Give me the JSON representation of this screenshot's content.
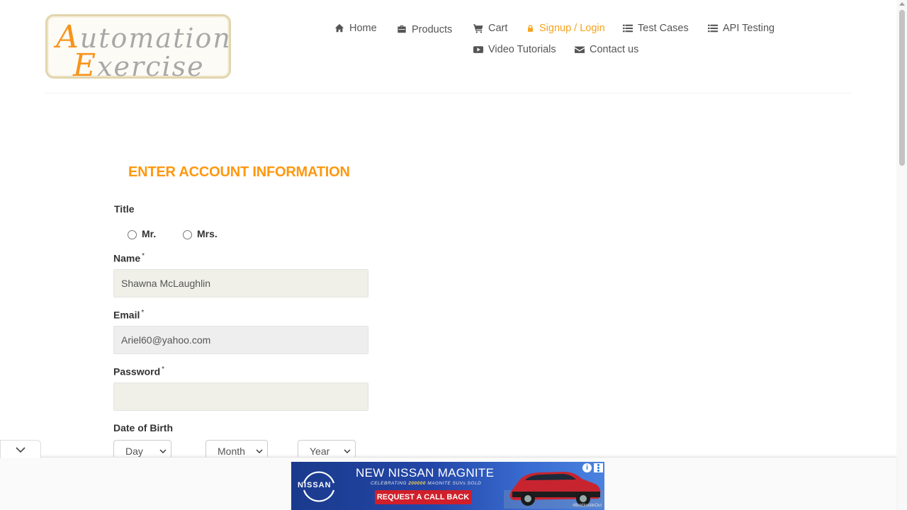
{
  "logo": {
    "line1_cap": "A",
    "line1_rest": "utomation",
    "line2_cap": "E",
    "line2_rest": "xercise"
  },
  "nav": {
    "items": [
      {
        "label": "Home",
        "icon": "home-icon",
        "active": false
      },
      {
        "label": "Products",
        "icon": "briefcase-icon",
        "active": false
      },
      {
        "label": "Cart",
        "icon": "cart-icon",
        "active": false
      },
      {
        "label": "Signup / Login",
        "icon": "lock-icon",
        "active": true
      },
      {
        "label": "Test Cases",
        "icon": "list-icon",
        "active": false
      },
      {
        "label": "API Testing",
        "icon": "list-icon",
        "active": false
      },
      {
        "label": "Video Tutorials",
        "icon": "youtube-play-icon",
        "active": false
      },
      {
        "label": "Contact us",
        "icon": "envelope-icon",
        "active": false
      }
    ]
  },
  "form": {
    "heading": "ENTER ACCOUNT INFORMATION",
    "title_label": "Title",
    "title_options": [
      "Mr.",
      "Mrs."
    ],
    "name_label": "Name",
    "name_value": "Shawna McLaughlin",
    "email_label": "Email",
    "email_value": "Ariel60@yahoo.com",
    "password_label": "Password",
    "password_value": "",
    "required_mark": "*",
    "dob_label": "Date of Birth",
    "dob": {
      "day": "Day",
      "month": "Month",
      "year": "Year"
    }
  },
  "ad": {
    "brand": "NISSAN",
    "headline": "NEW NISSAN MAGNITE",
    "sub_prefix": "CELEBRATING ",
    "sub_highlight": "200000",
    "sub_suffix": " MAGNITE SUVs SOLD",
    "cta": "REQUEST A CALL BACK",
    "hashtag": "#BoldInsideOut",
    "info": "i"
  },
  "colors": {
    "accent": "#fe980f",
    "nav_active": "#f7a21b",
    "ad_cta": "#d01f2a"
  }
}
